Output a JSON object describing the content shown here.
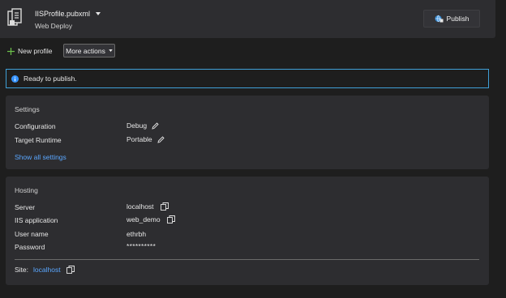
{
  "header": {
    "profile_name": "IISProfile.pubxml",
    "subtitle": "Web Deploy",
    "publish_label": "Publish"
  },
  "toolbar": {
    "new_profile_label": "New profile",
    "more_actions_label": "More actions"
  },
  "info_banner": {
    "text": "Ready to publish."
  },
  "settings": {
    "title": "Settings",
    "rows": [
      {
        "label": "Configuration",
        "value": "Debug"
      },
      {
        "label": "Target Runtime",
        "value": "Portable"
      }
    ],
    "show_all_label": "Show all settings"
  },
  "hosting": {
    "title": "Hosting",
    "rows": [
      {
        "label": "Server",
        "value": "localhost"
      },
      {
        "label": "IIS application",
        "value": "web_demo"
      },
      {
        "label": "User name",
        "value": "ethrbh"
      },
      {
        "label": "Password",
        "value": "**********"
      }
    ],
    "site_label": "Site:",
    "site_value": "localhost"
  },
  "colors": {
    "accent": "#3794ff",
    "banner_border": "#3f9fd6",
    "link": "#5aa7ff"
  }
}
